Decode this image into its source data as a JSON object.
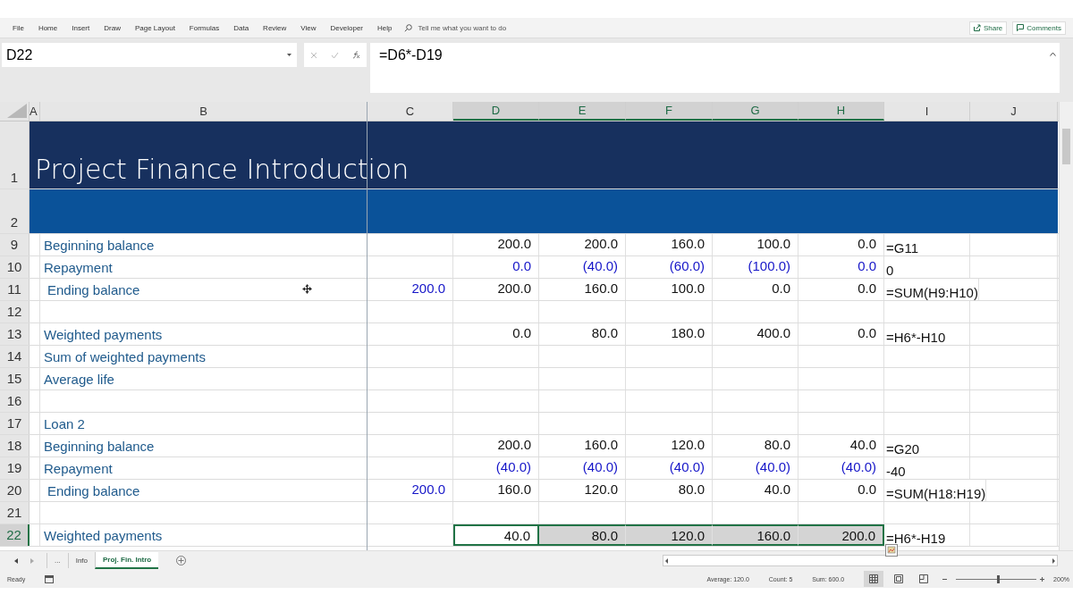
{
  "ribbon": {
    "tabs": [
      "File",
      "Home",
      "Insert",
      "Draw",
      "Page Layout",
      "Formulas",
      "Data",
      "Review",
      "View",
      "Developer",
      "Help"
    ],
    "search": {
      "placeholder": "Tell me what you want to do"
    },
    "share": "Share",
    "comments": "Comments"
  },
  "formula_bar": {
    "name_box": "D22",
    "formula": "=D6*-D19"
  },
  "columns": [
    {
      "label": "A",
      "selected": false
    },
    {
      "label": "B",
      "selected": false
    },
    {
      "label": "C",
      "selected": false
    },
    {
      "label": "D",
      "selected": true
    },
    {
      "label": "E",
      "selected": true
    },
    {
      "label": "F",
      "selected": true
    },
    {
      "label": "G",
      "selected": true
    },
    {
      "label": "H",
      "selected": true
    },
    {
      "label": "I",
      "selected": false
    },
    {
      "label": "J",
      "selected": false
    }
  ],
  "rows": [
    {
      "number": "1",
      "kind": "title",
      "title": "Project Finance Introduction",
      "selected": false
    },
    {
      "number": "2",
      "kind": "band",
      "selected": false
    },
    {
      "number": "9",
      "kind": "data",
      "label": "Beginning balance",
      "indented": false,
      "selected": false,
      "cells": {
        "D": {
          "text": "200.0",
          "kind": "calc",
          "selected": false
        },
        "E": {
          "text": "200.0",
          "kind": "calc",
          "selected": false
        },
        "F": {
          "text": "160.0",
          "kind": "calc",
          "selected": false
        },
        "G": {
          "text": "100.0",
          "kind": "calc",
          "selected": false
        },
        "H": {
          "text": "0.0",
          "kind": "calc",
          "selected": false
        },
        "I": {
          "text": "=G11",
          "kind": "formula",
          "selected": false
        }
      }
    },
    {
      "number": "10",
      "kind": "data",
      "label": "Repayment",
      "indented": false,
      "selected": false,
      "cells": {
        "D": {
          "text": "0.0",
          "kind": "input",
          "selected": false
        },
        "E": {
          "text": "(40.0)",
          "kind": "input",
          "selected": false
        },
        "F": {
          "text": "(60.0)",
          "kind": "input",
          "selected": false
        },
        "G": {
          "text": "(100.0)",
          "kind": "input",
          "selected": false
        },
        "H": {
          "text": "0.0",
          "kind": "input",
          "selected": false
        },
        "I": {
          "text": "0",
          "kind": "formula",
          "selected": false
        }
      }
    },
    {
      "number": "11",
      "kind": "data",
      "label": "Ending balance",
      "indented": true,
      "selected": false,
      "cells": {
        "C": {
          "text": "200.0",
          "kind": "input",
          "selected": false
        },
        "D": {
          "text": "200.0",
          "kind": "calc",
          "selected": false
        },
        "E": {
          "text": "160.0",
          "kind": "calc",
          "selected": false
        },
        "F": {
          "text": "100.0",
          "kind": "calc",
          "selected": false
        },
        "G": {
          "text": "0.0",
          "kind": "calc",
          "selected": false
        },
        "H": {
          "text": "0.0",
          "kind": "calc",
          "selected": false
        },
        "I": {
          "text": "=SUM(H9:H10)",
          "kind": "formula",
          "selected": false
        }
      }
    },
    {
      "number": "12",
      "kind": "data",
      "selected": false
    },
    {
      "number": "13",
      "kind": "data",
      "label": "Weighted payments",
      "indented": false,
      "selected": false,
      "cells": {
        "D": {
          "text": "0.0",
          "kind": "calc",
          "selected": false
        },
        "E": {
          "text": "80.0",
          "kind": "calc",
          "selected": false
        },
        "F": {
          "text": "180.0",
          "kind": "calc",
          "selected": false
        },
        "G": {
          "text": "400.0",
          "kind": "calc",
          "selected": false
        },
        "H": {
          "text": "0.0",
          "kind": "calc",
          "selected": false
        },
        "I": {
          "text": "=H6*-H10",
          "kind": "formula",
          "selected": false
        }
      }
    },
    {
      "number": "14",
      "kind": "data",
      "label": "Sum of weighted payments",
      "indented": false,
      "selected": false
    },
    {
      "number": "15",
      "kind": "data",
      "label": "Average life",
      "indented": false,
      "selected": false
    },
    {
      "number": "16",
      "kind": "data",
      "selected": false
    },
    {
      "number": "17",
      "kind": "data",
      "label": "Loan 2",
      "indented": false,
      "selected": false
    },
    {
      "number": "18",
      "kind": "data",
      "label": "Beginning balance",
      "indented": false,
      "selected": false,
      "cells": {
        "D": {
          "text": "200.0",
          "kind": "calc",
          "selected": false
        },
        "E": {
          "text": "160.0",
          "kind": "calc",
          "selected": false
        },
        "F": {
          "text": "120.0",
          "kind": "calc",
          "selected": false
        },
        "G": {
          "text": "80.0",
          "kind": "calc",
          "selected": false
        },
        "H": {
          "text": "40.0",
          "kind": "calc",
          "selected": false
        },
        "I": {
          "text": "=G20",
          "kind": "formula",
          "selected": false
        }
      }
    },
    {
      "number": "19",
      "kind": "data",
      "label": "Repayment",
      "indented": false,
      "selected": false,
      "cells": {
        "D": {
          "text": "(40.0)",
          "kind": "input",
          "selected": false
        },
        "E": {
          "text": "(40.0)",
          "kind": "input",
          "selected": false
        },
        "F": {
          "text": "(40.0)",
          "kind": "input",
          "selected": false
        },
        "G": {
          "text": "(40.0)",
          "kind": "input",
          "selected": false
        },
        "H": {
          "text": "(40.0)",
          "kind": "input",
          "selected": false
        },
        "I": {
          "text": "-40",
          "kind": "formula",
          "selected": false
        }
      }
    },
    {
      "number": "20",
      "kind": "data",
      "label": "Ending balance",
      "indented": true,
      "selected": false,
      "cells": {
        "C": {
          "text": "200.0",
          "kind": "input",
          "selected": false
        },
        "D": {
          "text": "160.0",
          "kind": "calc",
          "selected": false
        },
        "E": {
          "text": "120.0",
          "kind": "calc",
          "selected": false
        },
        "F": {
          "text": "80.0",
          "kind": "calc",
          "selected": false
        },
        "G": {
          "text": "40.0",
          "kind": "calc",
          "selected": false
        },
        "H": {
          "text": "0.0",
          "kind": "calc",
          "selected": false
        },
        "I": {
          "text": "=SUM(H18:H19)",
          "kind": "formula",
          "selected": false
        }
      }
    },
    {
      "number": "21",
      "kind": "data",
      "selected": false
    },
    {
      "number": "22",
      "kind": "data",
      "label": "Weighted payments",
      "indented": false,
      "selected": true,
      "cells": {
        "D": {
          "text": "40.0",
          "kind": "calc",
          "selected": true
        },
        "E": {
          "text": "80.0",
          "kind": "calc",
          "selected": true
        },
        "F": {
          "text": "120.0",
          "kind": "calc",
          "selected": true
        },
        "G": {
          "text": "160.0",
          "kind": "calc",
          "selected": true
        },
        "H": {
          "text": "200.0",
          "kind": "calc",
          "selected": true
        },
        "I": {
          "text": "=H6*-H19",
          "kind": "formula",
          "selected": false
        }
      }
    }
  ],
  "sheet_tabs": [
    {
      "label": "...",
      "selected": false
    },
    {
      "label": "Info",
      "selected": false
    },
    {
      "label": "Proj. Fin. Intro",
      "selected": true
    }
  ],
  "status_bar": {
    "mode": "Ready",
    "stats": [
      "Average: 120.0",
      "Count: 5",
      "Sum: 600.0"
    ],
    "views": [
      {
        "kind": "normal",
        "selected": true
      },
      {
        "kind": "page_layout",
        "selected": false
      },
      {
        "kind": "page_break",
        "selected": false
      }
    ],
    "zoom": {
      "level": 0.52,
      "label": "200%"
    }
  }
}
